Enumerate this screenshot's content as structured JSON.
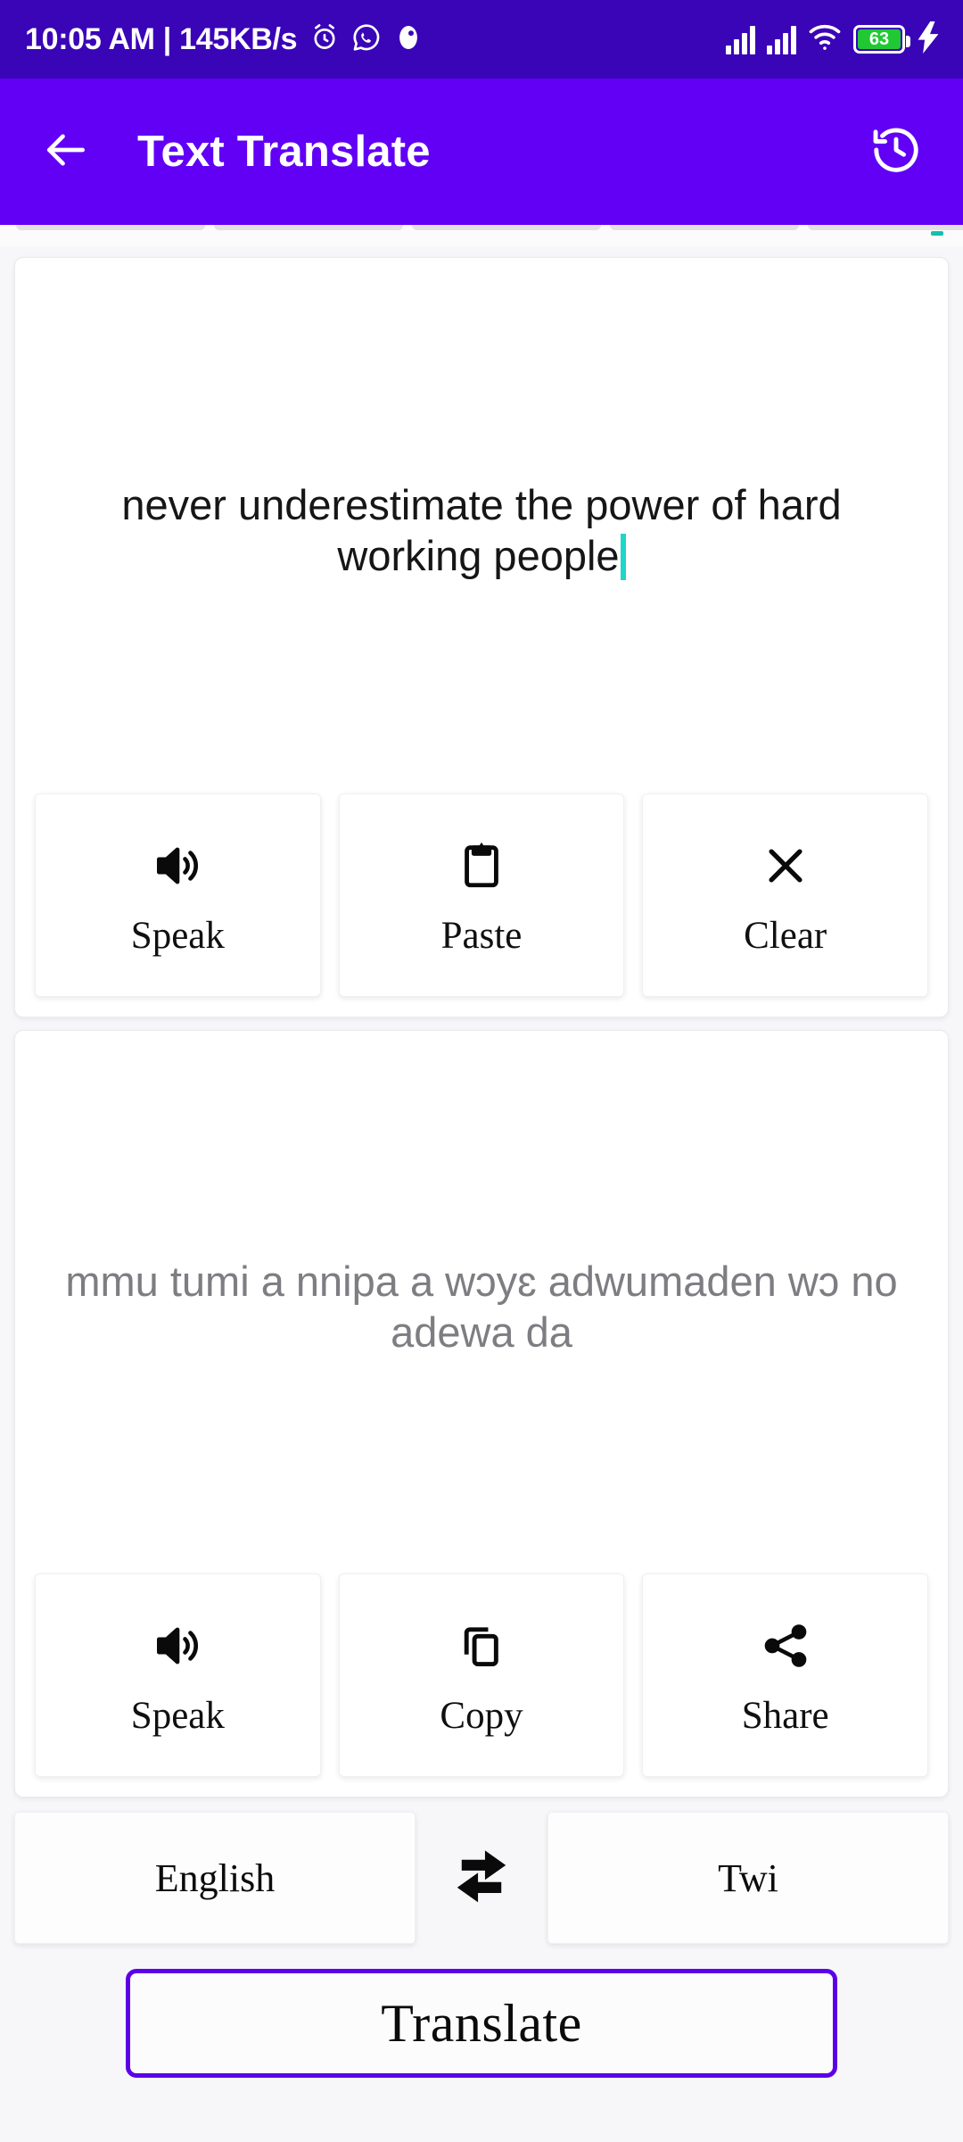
{
  "status_bar": {
    "clock": "10:05 AM | 145KB/s",
    "icons": [
      "alarm-icon",
      "whatsapp-icon",
      "app-icon"
    ],
    "battery_level": "63",
    "battery_color": "#20c933",
    "background": "#3a04b7",
    "signal_bars": 2,
    "wifi": true,
    "charging": true
  },
  "app_bar": {
    "title": "Text Translate",
    "back_icon": "back-arrow-icon",
    "history_icon": "history-icon",
    "background": "#6100f5",
    "text_color": "#ffffff"
  },
  "source_panel": {
    "text": "never underestimate the power of hard working people",
    "caret_color": "#1fd6c8",
    "text_color": "#161616",
    "actions": [
      {
        "label": "Speak",
        "icon": "volume-up-icon"
      },
      {
        "label": "Paste",
        "icon": "clipboard-icon"
      },
      {
        "label": "Clear",
        "icon": "close-x-icon"
      }
    ]
  },
  "target_panel": {
    "text": "mmu tumi a nnipa a wɔyɛ adwumaden wɔ no adewa da",
    "text_color": "#7d7d82",
    "actions": [
      {
        "label": "Speak",
        "icon": "volume-up-icon"
      },
      {
        "label": "Copy",
        "icon": "copy-icon"
      },
      {
        "label": "Share",
        "icon": "share-nodes-icon"
      }
    ]
  },
  "language_bar": {
    "source_language": "English",
    "target_language": "Twi",
    "swap_icon": "swap-horizontal-icon"
  },
  "translate_button": {
    "label": "Translate",
    "border_color": "#5c00e8",
    "background": "#fcfcfd"
  }
}
